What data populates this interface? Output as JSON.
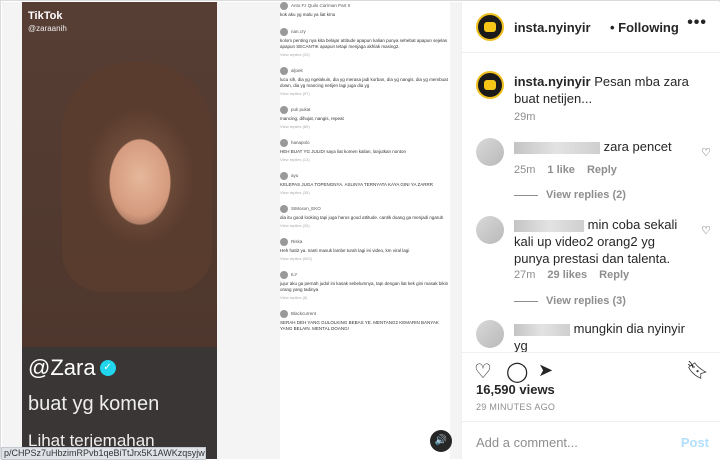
{
  "video": {
    "tiktok_brand": "TikTok",
    "tiktok_user": "@zaraanih",
    "caption_user": "@Zara",
    "caption_line1": "buat yg komen",
    "caption_line2": "Lihat terjemahan"
  },
  "tiktok_comments": [
    {
      "user": "Anto Fz Quilo Cia'iman Part II",
      "text": "kok aku yg malu ya liat kmu",
      "replies": ""
    },
    {
      "user": "nan.cry",
      "text": "kolom penting nya kita belajar attitude apapun kalian punya sehebat apapun sejelas apapun SECANTIK apapun tetapi menjaga akhlak masing2.",
      "replies": "View replies (20)"
    },
    {
      "user": "aljoek",
      "text": "lucu sih, dia yg ngelakuin, dia yg merasa jadi korban, dia yg nangis, dia yg membuat down, dia yg mancing netijen lagi juga dia yg",
      "replies": "View replies (97)"
    },
    {
      "user": "puk pukat",
      "text": "mancing, dihujat, nangis, repeat",
      "replies": "View replies (85)"
    },
    {
      "user": "hanapolo",
      "text": "HEH BUAT YG JULID! saya liat komen kalian, lanjutkan nonton",
      "replies": "View replies (13)"
    },
    {
      "user": "ayu",
      "text": "KELEPAS JUGA TOPENGNYA. ASLINYA TERNYATA KAYA GINI YA ZARRR",
      "replies": "View replies (35)"
    },
    {
      "user": "SIMoson_EKO",
      "text": "dia itu good looking tapi juga harus good attitude. cantik doang ga menjadi ngaruh",
      "replies": "View replies (26)"
    },
    {
      "user": "Riska",
      "text": "Heh hati2 ya. nanti masuk lambe turah lagi ini video, km viral lagi",
      "replies": "View replies (902)"
    },
    {
      "user": "ILY",
      "text": "jujur aku ga pernah judol ini kasak sebelumnya, tapi dengan liat kek gini masak bikin orang yang tadinya",
      "replies": "View replies (8)"
    },
    {
      "user": "Blackcurrent",
      "text": "SERAH DEH YANG GULOLKING BEBAS YE. MENTANG2 KEMARIN BANYAK YANG BELAIN. MENTAL DOANG!",
      "replies": ""
    }
  ],
  "url_fragment": "p/CHPSz7uHbzimRPvb1qeBiTtJrx5K1AWKzqsyjw0/",
  "header": {
    "username": "insta.nyinyir",
    "follow_label": "• Following",
    "more": "•••"
  },
  "caption": {
    "username": "insta.nyinyir",
    "text": "Pesan mba zara buat netijen...",
    "time": "29m"
  },
  "comments": [
    {
      "text": "zara pencet",
      "time": "25m",
      "likes": "1 like",
      "reply": "Reply",
      "replies": "View replies (2)"
    },
    {
      "text": "min coba sekali kali up video2 orang2 yg punya prestasi dan talenta.",
      "time": "27m",
      "likes": "29 likes",
      "reply": "Reply",
      "replies": "View replies (3)"
    },
    {
      "text": "mungkin dia nyinyir yg"
    }
  ],
  "views": "16,590 views",
  "time_ago": "29 MINUTES AGO",
  "add_comment": {
    "placeholder": "Add a comment...",
    "post_label": "Post"
  },
  "colors": {
    "link_blue_disabled": "#b2dffc",
    "muted": "#8e8e8e",
    "text": "#262626",
    "border": "#efefef"
  }
}
